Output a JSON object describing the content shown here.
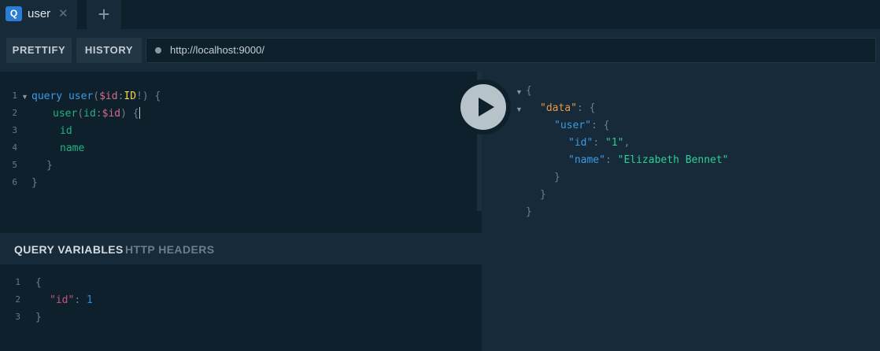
{
  "tabs": [
    {
      "badge": "Q",
      "title": "user",
      "close": "✕"
    }
  ],
  "add_tab": "+",
  "toolbar": {
    "prettify": "PRETTIFY",
    "history": "HISTORY",
    "url": "http://localhost:9000/"
  },
  "editor": {
    "line_numbers": [
      "1",
      "2",
      "3",
      "4",
      "5",
      "6"
    ],
    "line1": {
      "kw": "query",
      "name": "user",
      "p1": "(",
      "var": "$id",
      "colon": ":",
      "type": "ID",
      "p2": "!)",
      "brace": " {"
    },
    "line2": {
      "field": "user",
      "p1": "(",
      "arg": "id",
      "colon": ":",
      "var": "$id",
      "p2": ")",
      "brace": " {"
    },
    "line3": "id",
    "line4": "name",
    "line5": "}",
    "line6": "}"
  },
  "variables": {
    "tab_active": "QUERY VARIABLES",
    "tab_inactive": "HTTP HEADERS",
    "line_numbers": [
      "1",
      "2",
      "3"
    ],
    "line1": "{",
    "line2_key": "\"id\"",
    "line2_colon": ": ",
    "line2_val": "1",
    "line3": "}"
  },
  "result": {
    "l1": "{",
    "data_key": "\"data\"",
    "user_key": "\"user\"",
    "id_key": "\"id\"",
    "id_val": "\"1\"",
    "name_key": "\"name\"",
    "name_val": "\"Elizabeth Bennet\"",
    "colon_brace": ": {",
    "colon": ": ",
    "comma": ",",
    "close": "}"
  },
  "colors": {
    "accent": "#2b7cd3",
    "background": "#172a3a",
    "editor_bg": "#0f202d"
  }
}
